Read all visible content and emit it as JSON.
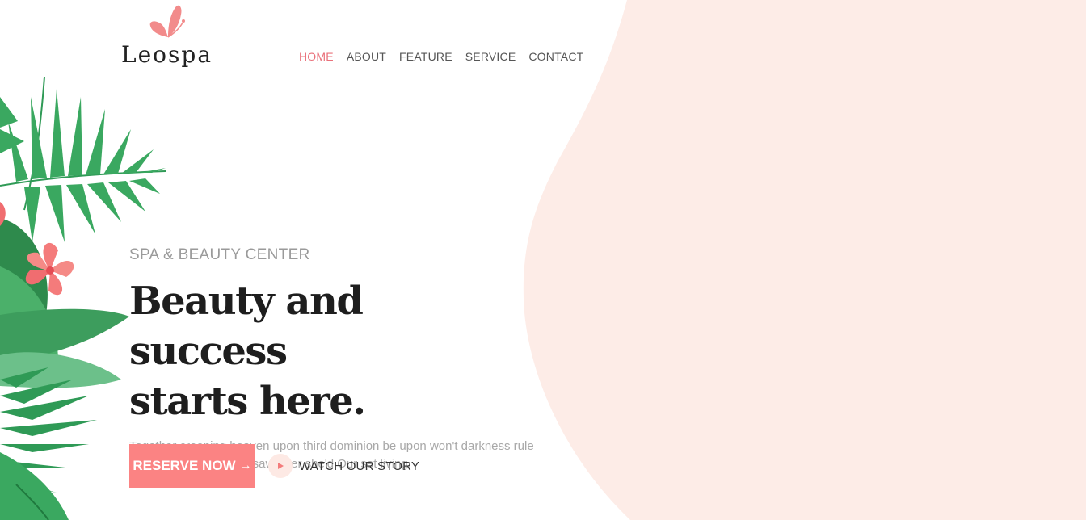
{
  "colors": {
    "accent": "#fb8383",
    "nav_active": "#e9707a",
    "blob": "#fdece7",
    "heading": "#1e1e1e",
    "muted": "#a8a8a8"
  },
  "header": {
    "logo_text": "Leospa",
    "logo_icon": "butterfly-icon",
    "nav": [
      {
        "label": "HOME",
        "active": true
      },
      {
        "label": "ABOUT",
        "active": false
      },
      {
        "label": "FEATURE",
        "active": false
      },
      {
        "label": "SERVICE",
        "active": false
      },
      {
        "label": "CONTACT",
        "active": false
      }
    ]
  },
  "hero": {
    "eyebrow": "SPA & BEAUTY CENTER",
    "headline_line1": "Beauty and success",
    "headline_line2": "starts here.",
    "description_line1": "Together creeping heaven upon third dominion be upon won't darkness rule",
    "description_line2": "behold it created good saw after she'd Our set living.",
    "reserve_label": "RESERVE NOW",
    "reserve_icon": "arrow-right-icon",
    "watch_label": "WATCH OUR STORY",
    "watch_icon": "play-icon"
  }
}
